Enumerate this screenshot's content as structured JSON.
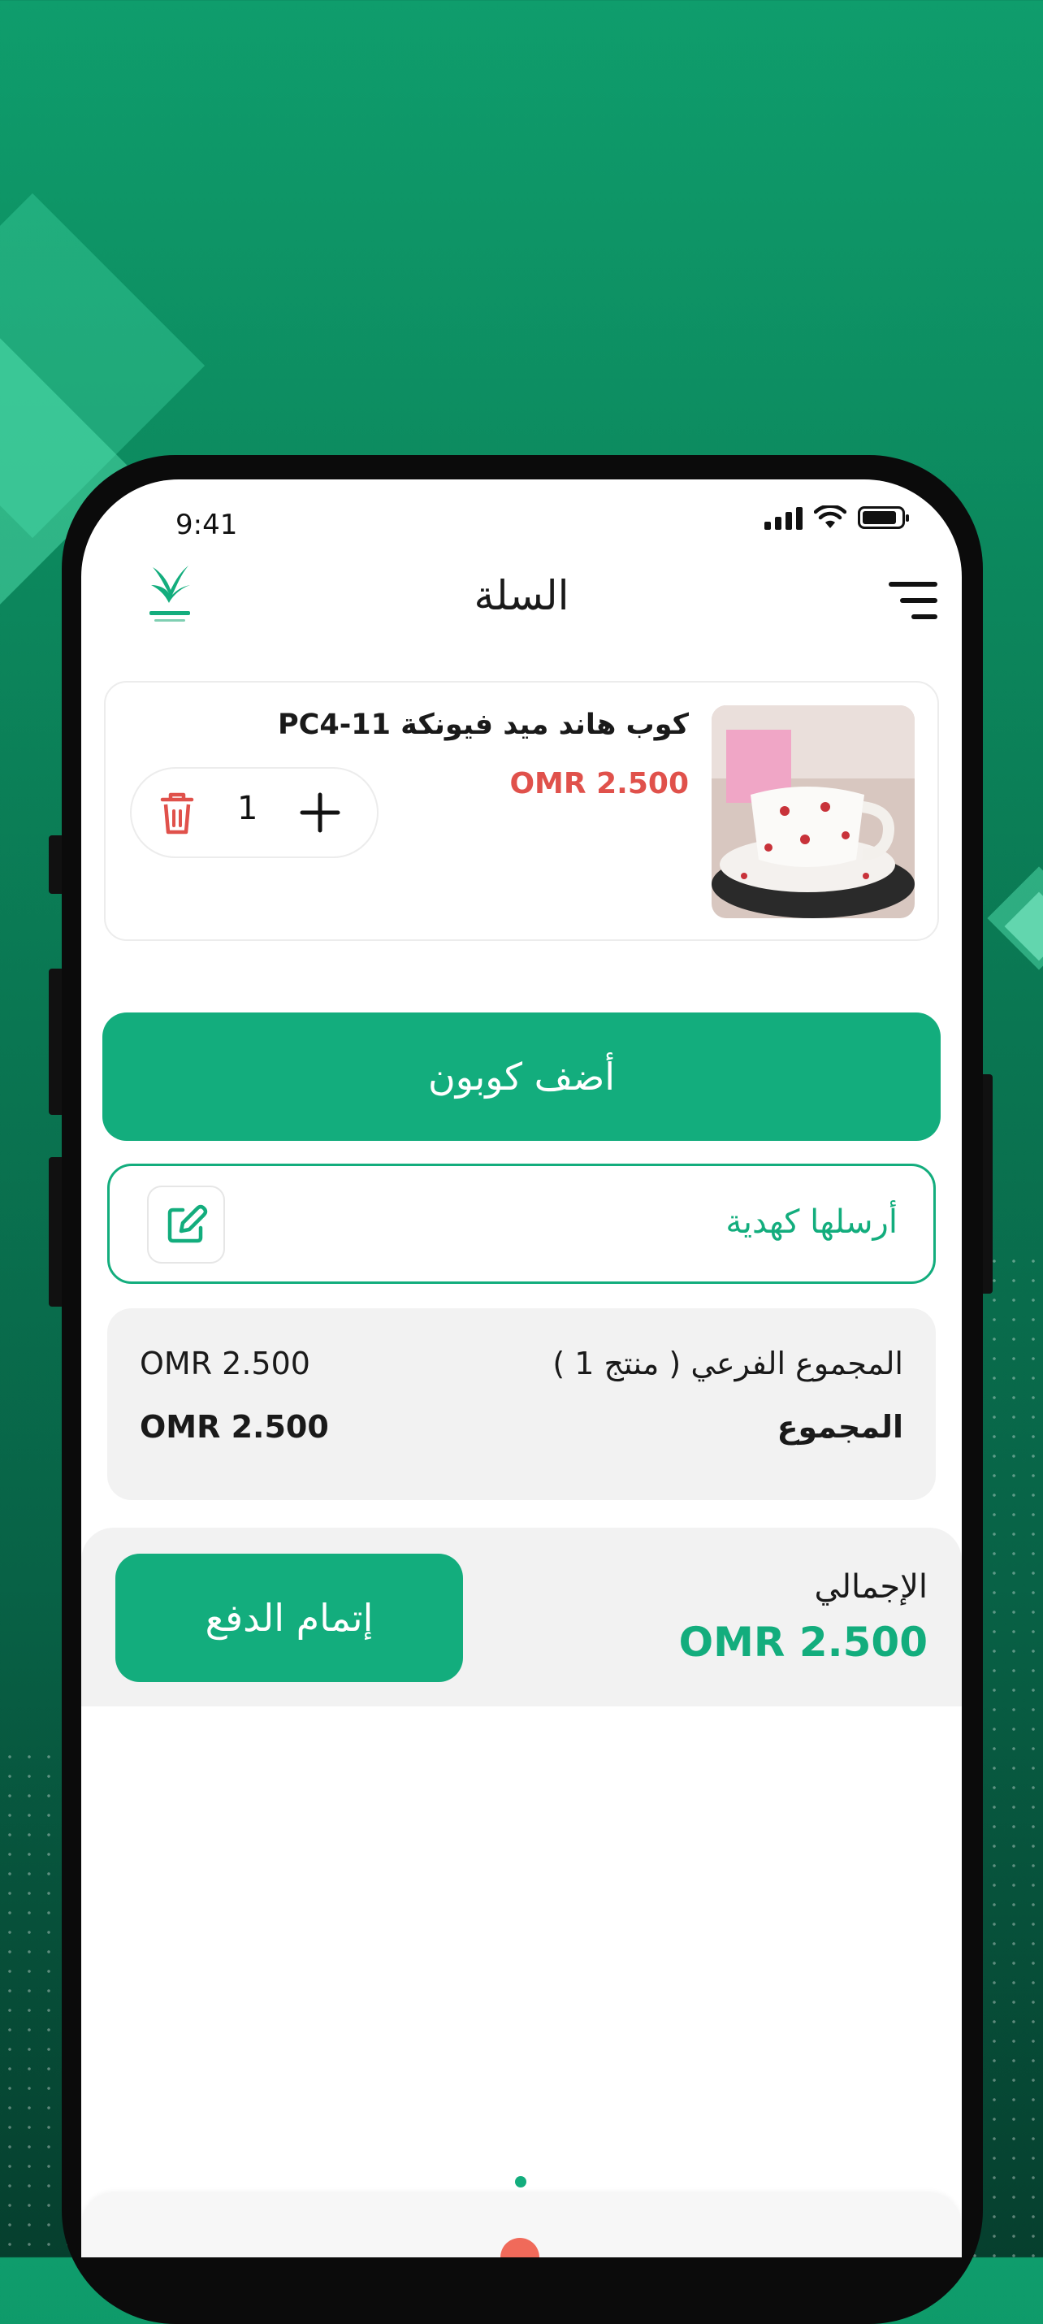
{
  "status_bar": {
    "time": "9:41"
  },
  "header": {
    "title": "السلة"
  },
  "cart_item": {
    "name": "كوب هاند ميد فيونكة PC4-11",
    "price": "OMR 2.500",
    "quantity": "1"
  },
  "coupon_button": {
    "label": "أضف كوبون"
  },
  "gift_row": {
    "label": "أرسلها كهدية"
  },
  "summary": {
    "subtotal_label": "المجموع الفرعي ( منتج 1 )",
    "subtotal_value": "OMR 2.500",
    "total_label": "المجموع",
    "total_value": "OMR 2.500"
  },
  "checkout": {
    "grand_total_label": "الإجمالي",
    "grand_total_value": "OMR 2.500",
    "pay_button": "إتمام الدفع"
  },
  "icons": [
    "menu-icon",
    "app-logo-bird",
    "trash-icon",
    "plus-icon",
    "edit-icon",
    "signal-icon",
    "wifi-icon",
    "battery-icon"
  ],
  "colors": {
    "accent": "#13ad7d",
    "price_red": "#e0514b",
    "background_green": "#0b7f57"
  }
}
